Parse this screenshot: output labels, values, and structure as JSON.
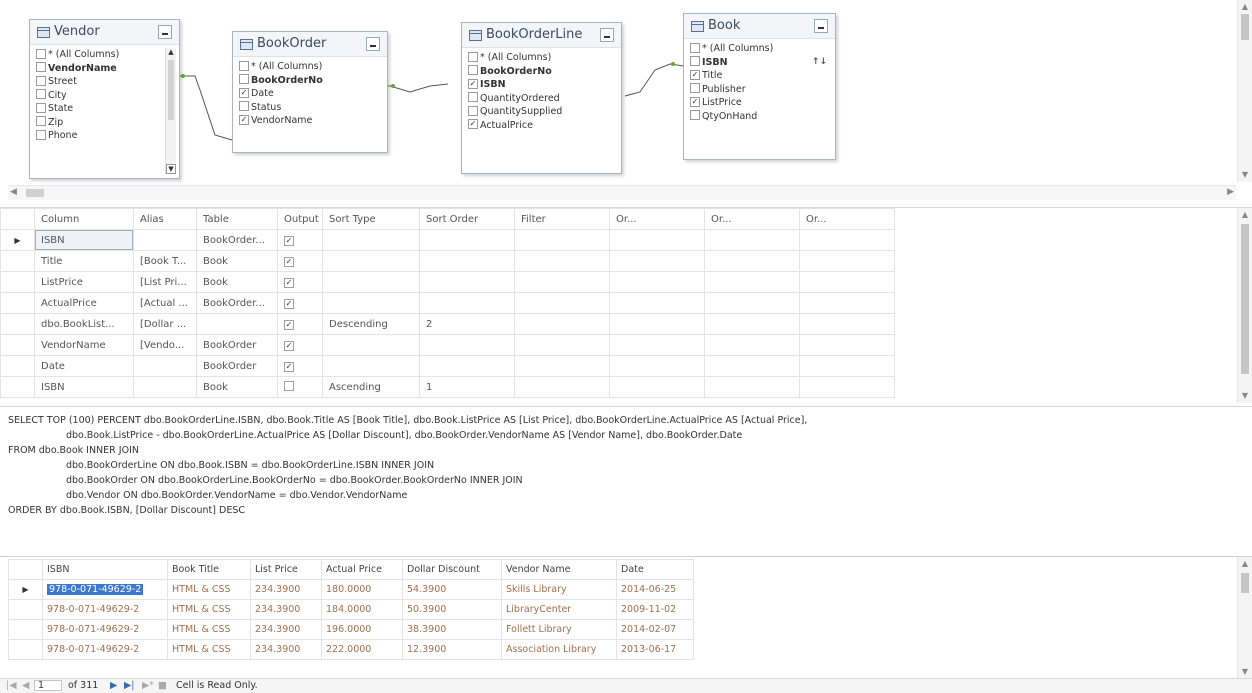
{
  "diagram": {
    "tables": [
      {
        "title": "Vendor",
        "columns": [
          {
            "label": "* (All Columns)",
            "checked": false,
            "bold": false
          },
          {
            "label": "VendorName",
            "checked": false,
            "bold": true
          },
          {
            "label": "Street",
            "checked": false,
            "bold": false
          },
          {
            "label": "City",
            "checked": false,
            "bold": false
          },
          {
            "label": "State",
            "checked": false,
            "bold": false
          },
          {
            "label": "Zip",
            "checked": false,
            "bold": false
          },
          {
            "label": "Phone",
            "checked": false,
            "bold": false
          }
        ]
      },
      {
        "title": "BookOrder",
        "columns": [
          {
            "label": "* (All Columns)",
            "checked": false,
            "bold": false
          },
          {
            "label": "BookOrderNo",
            "checked": false,
            "bold": true
          },
          {
            "label": "Date",
            "checked": true,
            "bold": false
          },
          {
            "label": "Status",
            "checked": false,
            "bold": false
          },
          {
            "label": "VendorName",
            "checked": true,
            "bold": false
          }
        ]
      },
      {
        "title": "BookOrderLine",
        "columns": [
          {
            "label": "* (All Columns)",
            "checked": false,
            "bold": false
          },
          {
            "label": "BookOrderNo",
            "checked": false,
            "bold": true
          },
          {
            "label": "ISBN",
            "checked": true,
            "bold": true
          },
          {
            "label": "QuantityOrdered",
            "checked": false,
            "bold": false
          },
          {
            "label": "QuantitySupplied",
            "checked": false,
            "bold": false
          },
          {
            "label": "ActualPrice",
            "checked": true,
            "bold": false
          }
        ]
      },
      {
        "title": "Book",
        "columns": [
          {
            "label": "* (All Columns)",
            "checked": false,
            "bold": false
          },
          {
            "label": "ISBN",
            "checked": false,
            "bold": true
          },
          {
            "label": "Title",
            "checked": true,
            "bold": false
          },
          {
            "label": "Publisher",
            "checked": false,
            "bold": false
          },
          {
            "label": "ListPrice",
            "checked": true,
            "bold": false
          },
          {
            "label": "QtyOnHand",
            "checked": false,
            "bold": false
          }
        ]
      }
    ],
    "isbn_sort_mark": "↑↓"
  },
  "criteria": {
    "headers": [
      "Column",
      "Alias",
      "Table",
      "Output",
      "Sort Type",
      "Sort Order",
      "Filter",
      "Or...",
      "Or...",
      "Or..."
    ],
    "rows": [
      {
        "column": "ISBN",
        "alias": "",
        "table": "BookOrder...",
        "output": true,
        "sort_type": "",
        "sort_order": ""
      },
      {
        "column": "Title",
        "alias": "[Book T...",
        "table": "Book",
        "output": true,
        "sort_type": "",
        "sort_order": ""
      },
      {
        "column": "ListPrice",
        "alias": "[List Pri...",
        "table": "Book",
        "output": true,
        "sort_type": "",
        "sort_order": ""
      },
      {
        "column": "ActualPrice",
        "alias": "[Actual ...",
        "table": "BookOrder...",
        "output": true,
        "sort_type": "",
        "sort_order": ""
      },
      {
        "column": "dbo.BookList...",
        "alias": "[Dollar ...",
        "table": "",
        "output": true,
        "sort_type": "Descending",
        "sort_order": "2"
      },
      {
        "column": "VendorName",
        "alias": "[Vendo...",
        "table": "BookOrder",
        "output": true,
        "sort_type": "",
        "sort_order": ""
      },
      {
        "column": "Date",
        "alias": "",
        "table": "BookOrder",
        "output": true,
        "sort_type": "",
        "sort_order": ""
      },
      {
        "column": "ISBN",
        "alias": "",
        "table": "Book",
        "output": false,
        "sort_type": "Ascending",
        "sort_order": "1"
      }
    ]
  },
  "sql": {
    "lines": [
      "SELECT TOP (100) PERCENT dbo.BookOrderLine.ISBN, dbo.Book.Title AS [Book Title], dbo.Book.ListPrice AS [List Price], dbo.BookOrderLine.ActualPrice AS [Actual Price],",
      "dbo.Book.ListPrice - dbo.BookOrderLine.ActualPrice AS [Dollar Discount], dbo.BookOrder.VendorName AS [Vendor Name], dbo.BookOrder.Date",
      "FROM     dbo.Book INNER JOIN",
      "dbo.BookOrderLine ON dbo.Book.ISBN = dbo.BookOrderLine.ISBN INNER JOIN",
      "dbo.BookOrder ON dbo.BookOrderLine.BookOrderNo = dbo.BookOrder.BookOrderNo INNER JOIN",
      "dbo.Vendor ON dbo.BookOrder.VendorName = dbo.Vendor.VendorName",
      "ORDER BY dbo.Book.ISBN, [Dollar Discount] DESC"
    ]
  },
  "results": {
    "headers": [
      "ISBN",
      "Book Title",
      "List Price",
      "Actual Price",
      "Dollar Discount",
      "Vendor Name",
      "Date"
    ],
    "rows": [
      [
        "978-0-071-49629-2",
        "HTML & CSS",
        "234.3900",
        "180.0000",
        "54.3900",
        "Skills Library",
        "2014-06-25"
      ],
      [
        "978-0-071-49629-2",
        "HTML & CSS",
        "234.3900",
        "184.0000",
        "50.3900",
        "LibraryCenter",
        "2009-11-02"
      ],
      [
        "978-0-071-49629-2",
        "HTML & CSS",
        "234.3900",
        "196.0000",
        "38.3900",
        "Follett Library",
        "2014-02-07"
      ],
      [
        "978-0-071-49629-2",
        "HTML & CSS",
        "234.3900",
        "222.0000",
        "12.3900",
        "Association Library",
        "2013-06-17"
      ]
    ]
  },
  "navbar": {
    "position": "1",
    "of_total": "of 311",
    "status": "Cell is Read Only."
  }
}
